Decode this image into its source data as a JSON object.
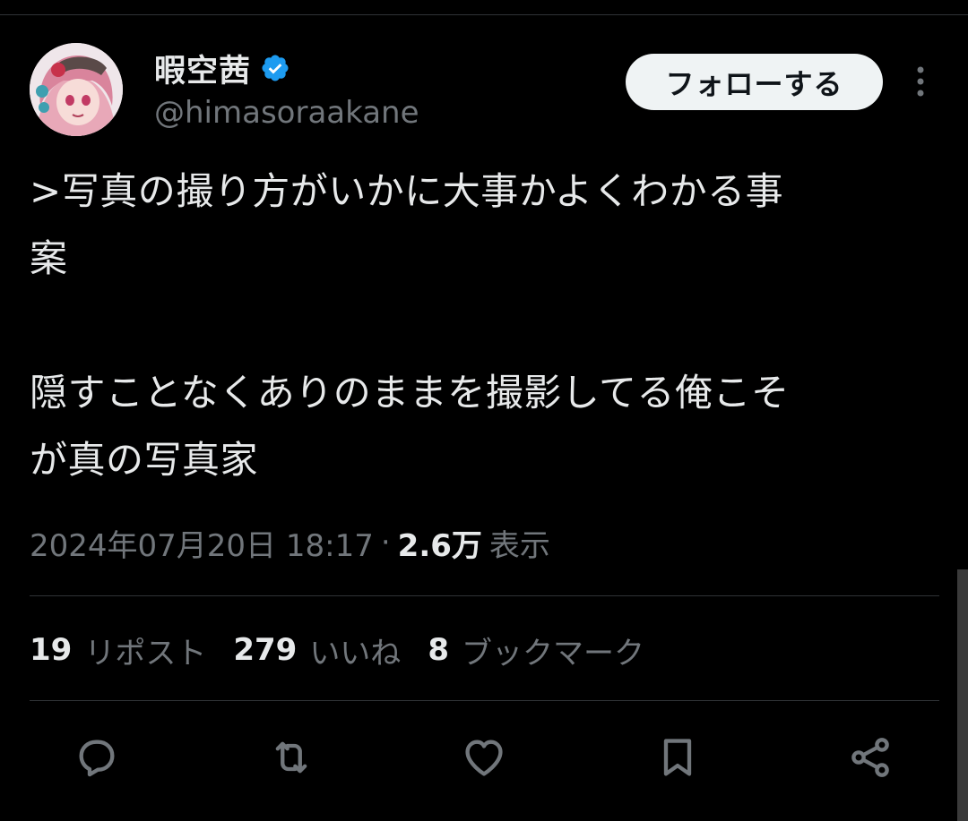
{
  "author": {
    "display_name": "暇空茜",
    "handle": "@himasoraakane",
    "verified": true
  },
  "follow_button_label": "フォローする",
  "tweet": {
    "text": ">写真の撮り方がいかに大事かよくわかる事\n案\n\n隠すことなくありのままを撮影してる俺こそ\nが真の写真家",
    "timestamp": "2024年07月20日 18:17",
    "separator": "·",
    "views_count": "2.6万",
    "views_label": "表示"
  },
  "stats": {
    "reposts": {
      "count": "19",
      "label": "リポスト"
    },
    "likes": {
      "count": "279",
      "label": "いいね"
    },
    "bookmarks": {
      "count": "8",
      "label": "ブックマーク"
    }
  },
  "icons": {
    "reply": "reply-icon",
    "repost": "repost-icon",
    "like": "heart-icon",
    "bookmark": "bookmark-icon",
    "share": "share-icon",
    "more": "more-vertical-icon",
    "verified": "verified-badge-icon"
  },
  "colors": {
    "background": "#000000",
    "text_primary": "#e7e9ea",
    "text_secondary": "#71767b",
    "divider": "#2f3336",
    "verified_blue": "#1d9bf0",
    "follow_button_bg": "#eff3f4"
  }
}
